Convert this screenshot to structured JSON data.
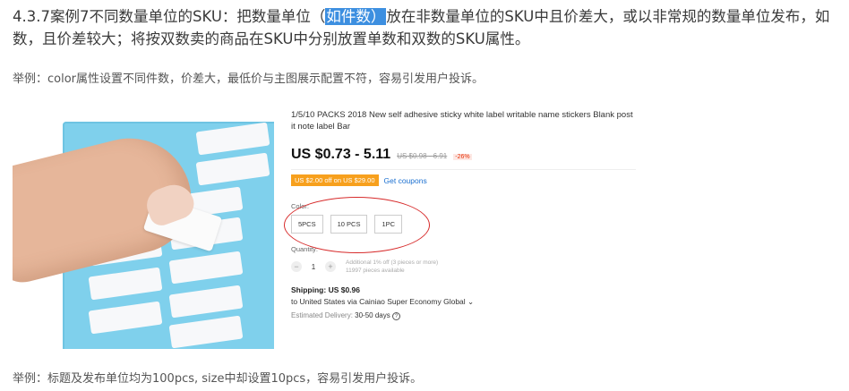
{
  "heading": {
    "before": "4.3.7案例7不同数量单位的SKU：把数量单位（",
    "highlight": "如件数）",
    "after": "放在非数量单位的SKU中且价差大，或以非常规的数量单位发布，如数，且价差较大；将按双数卖的商品在SKU中分别放置单数和双数的SKU属性。"
  },
  "examples": [
    "举例：color属性设置不同件数，价差大，最低价与主图展示配置不符，容易引发用户投诉。",
    "举例：标题及发布单位均为100pcs, size中却设置10pcs，容易引发用户投诉。"
  ],
  "product": {
    "title": "1/5/10 PACKS 2018 New self adhesive sticky white label writable name stickers Blank post it note label Bar",
    "price": "US $0.73 - 5.11",
    "old_price": "US $0.98 - 6.91",
    "discount": "-26%",
    "coupon": "US $2.00 off on US $29.00",
    "get_coupons": "Get coupons",
    "color_label": "Color:",
    "sku_options": [
      "5PCS",
      "10 PCS",
      "1PC"
    ],
    "quantity_label": "Quantity:",
    "quantity_value": "1",
    "quantity_minus": "−",
    "quantity_plus": "+",
    "quantity_hint_1": "Additional 1% off (3 pieces or more)",
    "quantity_hint_2": "11997 pieces available",
    "shipping_label": "Shipping:",
    "shipping_price": "US $0.96",
    "shipping_route": "to United States via Cainiao Super Economy Global ⌄",
    "delivery_label": "Estimated Delivery:",
    "delivery_value": "30-50 days",
    "delivery_icon": "?"
  },
  "colors": {
    "highlight": "#3d8fe0",
    "annotation_circle": "#d72a2a",
    "coupon": "#f7a01d",
    "link": "#1a6fd0",
    "discount": "#e62e04"
  }
}
